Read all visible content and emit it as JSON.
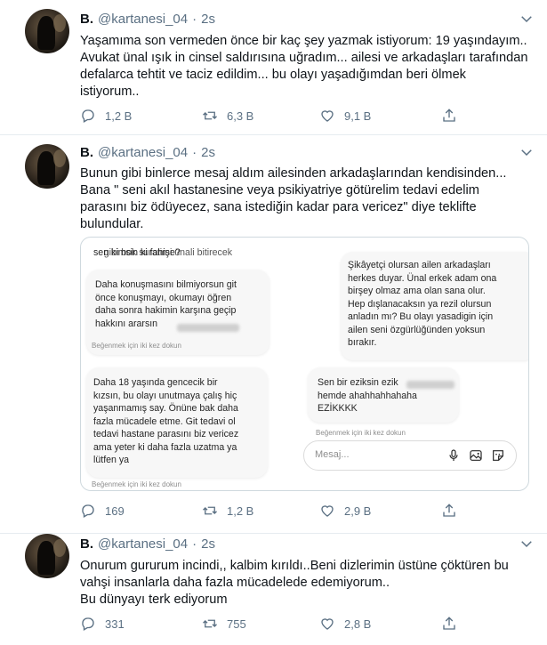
{
  "tweets": [
    {
      "name": "B.",
      "handle": "@kartanesi_04",
      "dot": "·",
      "time": "2s",
      "lines": [
        "Yaşamıma son vermeden önce bir kaç şey yazmak istiyorum: 19 yaşındayım..",
        "Avukat ünal ışık in cinsel saldırısına uğradım... ailesi ve arkadaşları tarafından",
        "defalarca tehtit ve taciz edildim... bu olayı yaşadığımdan beri ölmek",
        "istiyorum.."
      ],
      "replies": "1,2 B",
      "retweets": "6,3 B",
      "likes": "9,1 B"
    },
    {
      "name": "B.",
      "handle": "@kartanesi_04",
      "dot": "·",
      "time": "2s",
      "lines": [
        "Bunun gibi binlerce mesaj aldım ailesinden arkadaşlarından kendisinden...",
        "Bana \" seni akıl hastanesine veya psikiyatriye götürelim tedavi edelim",
        "parasını biz ödüyecez, sana istediğin kadar para vericez\" diye teklifte",
        "bulundular."
      ],
      "replies": "169",
      "retweets": "1,2 B",
      "likes": "2,9 B"
    },
    {
      "name": "B.",
      "handle": "@kartanesi_04",
      "dot": "·",
      "time": "2s",
      "lines": [
        "Onurum gururum incindi,, kalbim kırıldı..Beni dizlerimin üstüne çöktüren bu",
        "vahşi insanlarla  daha fazla mücadelede edemiyorum..",
        "Bu dünyayı terk ediyorum"
      ],
      "replies": "331",
      "retweets": "755",
      "likes": "2,8 B"
    }
  ],
  "screenshot": {
    "msg1_top": "gibi bok suratimi ünali bitirecek",
    "msg1": "sen kimsin ki fahişe?",
    "msg2": "Daha konuşmasını bilmiyorsun git\nönce konuşmayı, okumayı öğren\ndaha sonra hakimin karşına geçip\nhakkını ararsın",
    "msg3": "Şikâyetçi olursan ailen arkadaşları\nherkes duyar. Ünal erkek adam ona\nbirşey olmaz ama olan sana olur.\nHep dışlanacaksın ya rezil olursun\nanladın mı? Bu olayı yasadigin için\nailen seni özgürlüğünden yoksun\nbırakır.",
    "msg4": "Daha 18 yaşında gencecik bir\nkızsın, bu olayı unutmaya çalış hiç\nyaşanmamış say. Önüne bak daha\nfazla mücadele etme. Git tedavi ol\ntedavi hastane parasını biz vericez\nama yeter ki daha fazla uzatma ya\nlütfen ya",
    "msg5": "Sen bir eziksin ezik\nhemde ahahhahhahaha\nEZİKKKK",
    "like_hint": "Beğenmek için iki kez dokun",
    "message_placeholder": "Mesaj..."
  }
}
